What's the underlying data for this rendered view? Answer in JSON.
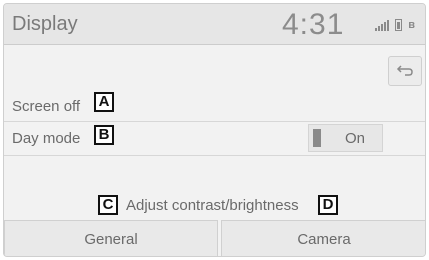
{
  "header": {
    "title": "Display",
    "time": "4:31"
  },
  "status_icons": [
    "signal-icon",
    "battery-icon",
    "bluetooth-icon"
  ],
  "settings": {
    "screen_off_label": "Screen off",
    "day_mode_label": "Day mode",
    "day_mode_value": "On"
  },
  "adjust_label": "Adjust contrast/brightness",
  "tabs": [
    {
      "label": "General"
    },
    {
      "label": "Camera"
    }
  ],
  "callouts": {
    "a": "A",
    "b": "B",
    "c": "C",
    "d": "D"
  }
}
